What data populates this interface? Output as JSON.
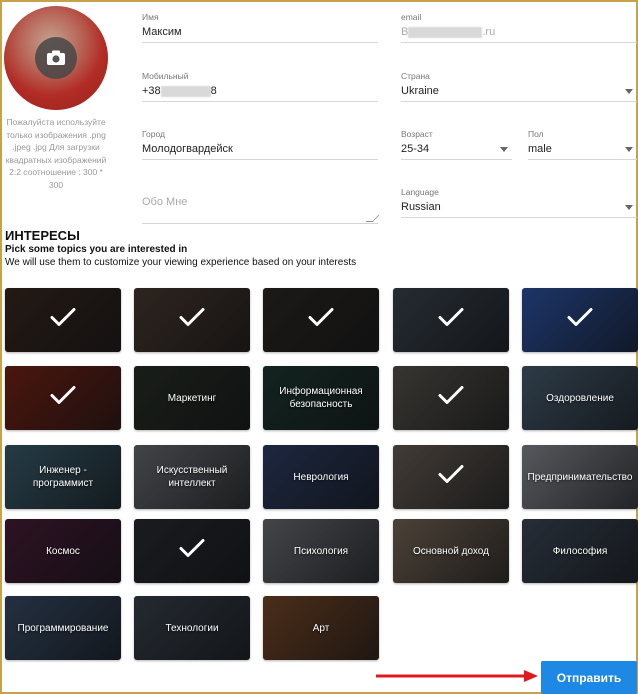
{
  "profile": {
    "upload_hint": "Пожалуйста используйте только изображения .png .jpeg .jpg Для загрузки квадратных изображений 2:2 соотношение : 300 * 300"
  },
  "form": {
    "name": {
      "label": "Имя",
      "value": "Максим"
    },
    "email": {
      "label": "email",
      "prefix": "B",
      "suffix": ".ru"
    },
    "mobile": {
      "label": "Мобильный",
      "prefix": "+38",
      "suffix": "8"
    },
    "country": {
      "label": "Страна",
      "value": "Ukraine"
    },
    "city": {
      "label": "Город",
      "value": "Молодогвардейск"
    },
    "age": {
      "label": "Возраст",
      "value": "25-34"
    },
    "gender": {
      "label": "Пол",
      "value": "male"
    },
    "about": {
      "placeholder": "Обо Мне"
    },
    "language": {
      "label": "Language",
      "value": "Russian"
    }
  },
  "interests": {
    "title": "ИНТЕРЕСЫ",
    "subtitle": "Pick some topics you are interested in",
    "description": "We will use them to customize your viewing experience based on your interests",
    "tiles": [
      {
        "label": "",
        "checked": true,
        "bg": "#3a2a22"
      },
      {
        "label": "",
        "checked": true,
        "bg": "#4b3b33"
      },
      {
        "label": "",
        "checked": true,
        "bg": "#2e2a26"
      },
      {
        "label": "",
        "checked": true,
        "bg": "#3d4752"
      },
      {
        "label": "",
        "checked": true,
        "bg": "#2f56a8"
      },
      {
        "label": "",
        "checked": true,
        "bg": "#7a2418"
      },
      {
        "label": "Маркетинг",
        "checked": false,
        "bg": "#2a3028"
      },
      {
        "label": "Информационная безопасность",
        "checked": false,
        "bg": "#1f3a33"
      },
      {
        "label": "",
        "checked": true,
        "bg": "#5a5650"
      },
      {
        "label": "Оздоровление",
        "checked": false,
        "bg": "#4a5f73"
      },
      {
        "label": "Инженер - программист",
        "checked": false,
        "bg": "#3d6070"
      },
      {
        "label": "Искусственный интеллект",
        "checked": false,
        "bg": "#6b6f74"
      },
      {
        "label": "Неврология",
        "checked": false,
        "bg": "#2f3f66"
      },
      {
        "label": "",
        "checked": true,
        "bg": "#6a6058"
      },
      {
        "label": "Предпринимательство",
        "checked": false,
        "bg": "#8b8f96"
      },
      {
        "label": "Космос",
        "checked": false,
        "bg": "#4a1e3a"
      },
      {
        "label": "",
        "checked": true,
        "bg": "#2a2d33"
      },
      {
        "label": "Психология",
        "checked": false,
        "bg": "#6e7076"
      },
      {
        "label": "Основной доход",
        "checked": false,
        "bg": "#7a6a5a"
      },
      {
        "label": "Философия",
        "checked": false,
        "bg": "#3e4a5a"
      },
      {
        "label": "Программирование",
        "checked": false,
        "bg": "#3a4e6a"
      },
      {
        "label": "Технологии",
        "checked": false,
        "bg": "#3b4450"
      },
      {
        "label": "Арт",
        "checked": false,
        "bg": "#7a4a2a"
      }
    ]
  },
  "submit_label": "Отправить",
  "colors": {
    "accent": "#1e88e5",
    "arrow": "#e0191f"
  },
  "icons": {
    "camera": "camera-icon",
    "check": "checkmark-icon",
    "arrow": "arrow-right-icon"
  }
}
